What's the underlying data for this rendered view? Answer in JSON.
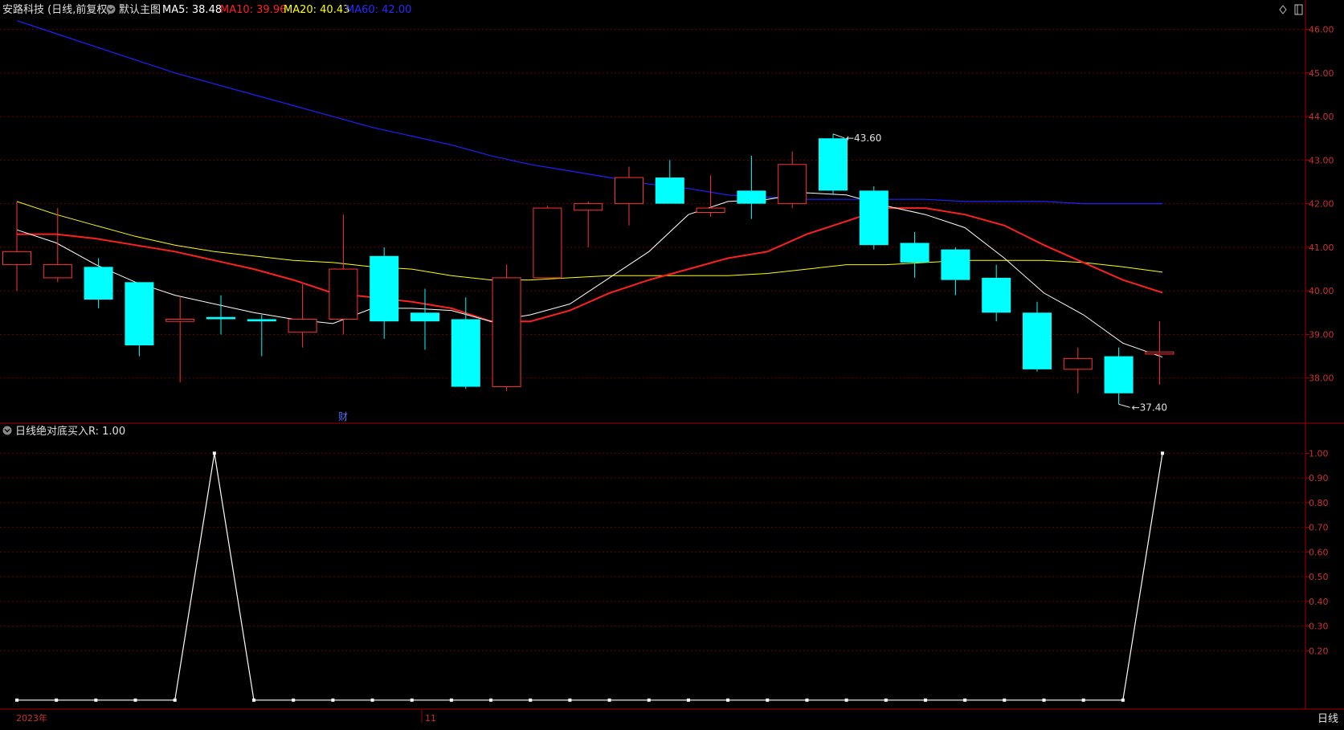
{
  "header": {
    "stock_title": "安路科技 (日线,前复权)",
    "main_chart_label": "默认主图",
    "ma5": {
      "label": "MA5: 38.48",
      "color": "#FFFFFF"
    },
    "ma10": {
      "label": "MA10: 39.96",
      "color": "#FF2020"
    },
    "ma20": {
      "label": "MA20: 40.43",
      "color": "#FFFF00"
    },
    "ma60": {
      "label": "MA60: 42.00",
      "color": "#2020FF"
    }
  },
  "indicator_header": {
    "name": "日线绝对底",
    "value_label": "买入R: 1.00"
  },
  "footer": {
    "period_label": "日线",
    "year_label": "2023年",
    "month_label": "11"
  },
  "annotations": {
    "high_label": "43.60",
    "low_label": "37.40",
    "event_marker": "财"
  },
  "colors": {
    "up": "#FF3232",
    "down": "#00FFFF",
    "axis": "#AA0000",
    "grid": "#6A0000",
    "tick_text": "#C83232",
    "indicator_line": "#FFFFFF"
  },
  "chart_data": [
    {
      "type": "candlestick",
      "title": "安路科技 (日线,前复权)",
      "ylim": [
        37.0,
        46.6
      ],
      "y_ticks": [
        38.0,
        39.0,
        40.0,
        41.0,
        42.0,
        43.0,
        44.0,
        45.0,
        46.0
      ],
      "y_tick_labels": [
        "38.00",
        "39.00",
        "40.00",
        "41.00",
        "42.00",
        "43.00",
        "44.00",
        "45.00",
        "46.00"
      ],
      "candles": [
        {
          "o": 40.6,
          "h": 42.05,
          "l": 40.0,
          "c": 40.9
        },
        {
          "o": 40.3,
          "h": 41.9,
          "l": 40.2,
          "c": 40.6
        },
        {
          "o": 40.55,
          "h": 40.75,
          "l": 39.6,
          "c": 39.8
        },
        {
          "o": 40.2,
          "h": 40.2,
          "l": 38.5,
          "c": 38.75
        },
        {
          "o": 39.3,
          "h": 39.85,
          "l": 37.9,
          "c": 39.35
        },
        {
          "o": 39.4,
          "h": 39.9,
          "l": 39.0,
          "c": 39.35
        },
        {
          "o": 39.35,
          "h": 39.45,
          "l": 38.5,
          "c": 39.3
        },
        {
          "o": 39.05,
          "h": 40.15,
          "l": 38.7,
          "c": 39.35
        },
        {
          "o": 39.35,
          "h": 41.75,
          "l": 39.0,
          "c": 40.5
        },
        {
          "o": 40.8,
          "h": 41.0,
          "l": 38.9,
          "c": 39.3
        },
        {
          "o": 39.5,
          "h": 40.05,
          "l": 38.65,
          "c": 39.3
        },
        {
          "o": 39.35,
          "h": 39.85,
          "l": 37.75,
          "c": 37.8
        },
        {
          "o": 37.8,
          "h": 40.6,
          "l": 37.7,
          "c": 40.3
        },
        {
          "o": 40.3,
          "h": 41.95,
          "l": 40.3,
          "c": 41.9
        },
        {
          "o": 41.85,
          "h": 42.05,
          "l": 41.0,
          "c": 42.0
        },
        {
          "o": 42.0,
          "h": 42.85,
          "l": 41.5,
          "c": 42.6
        },
        {
          "o": 42.6,
          "h": 43.0,
          "l": 42.0,
          "c": 42.0
        },
        {
          "o": 41.8,
          "h": 42.65,
          "l": 41.7,
          "c": 41.9
        },
        {
          "o": 42.3,
          "h": 43.1,
          "l": 41.65,
          "c": 42.0
        },
        {
          "o": 42.0,
          "h": 43.2,
          "l": 41.9,
          "c": 42.9
        },
        {
          "o": 43.5,
          "h": 43.6,
          "l": 42.2,
          "c": 42.3
        },
        {
          "o": 42.3,
          "h": 42.4,
          "l": 40.95,
          "c": 41.05
        },
        {
          "o": 41.1,
          "h": 41.35,
          "l": 40.3,
          "c": 40.65
        },
        {
          "o": 40.95,
          "h": 41.0,
          "l": 39.9,
          "c": 40.25
        },
        {
          "o": 40.3,
          "h": 40.6,
          "l": 39.3,
          "c": 39.5
        },
        {
          "o": 39.5,
          "h": 39.75,
          "l": 38.15,
          "c": 38.2
        },
        {
          "o": 38.2,
          "h": 38.7,
          "l": 37.65,
          "c": 38.45
        },
        {
          "o": 38.5,
          "h": 38.7,
          "l": 37.4,
          "c": 37.65
        },
        {
          "o": 38.55,
          "h": 39.3,
          "l": 37.85,
          "c": 38.6
        }
      ],
      "ma5": [
        41.4,
        41.1,
        40.6,
        40.2,
        39.9,
        39.7,
        39.5,
        39.35,
        39.25,
        39.6,
        39.6,
        39.55,
        39.3,
        39.45,
        39.7,
        40.3,
        40.9,
        41.75,
        42.05,
        42.1,
        42.25,
        42.2,
        41.95,
        41.75,
        41.45,
        40.75,
        39.95,
        39.45,
        38.8,
        38.48
      ],
      "ma10": [
        41.3,
        41.3,
        41.2,
        41.05,
        40.9,
        40.7,
        40.5,
        40.25,
        39.95,
        39.85,
        39.75,
        39.6,
        39.3,
        39.3,
        39.55,
        39.95,
        40.25,
        40.5,
        40.75,
        40.9,
        41.3,
        41.6,
        41.9,
        41.9,
        41.75,
        41.5,
        41.05,
        40.65,
        40.25,
        39.96
      ],
      "ma20": [
        42.05,
        41.75,
        41.5,
        41.25,
        41.05,
        40.9,
        40.8,
        40.7,
        40.65,
        40.55,
        40.5,
        40.35,
        40.25,
        40.25,
        40.3,
        40.35,
        40.35,
        40.35,
        40.35,
        40.4,
        40.5,
        40.6,
        40.6,
        40.65,
        40.7,
        40.7,
        40.7,
        40.65,
        40.55,
        40.43
      ],
      "ma60": [
        46.2,
        45.9,
        45.6,
        45.3,
        45.0,
        44.75,
        44.5,
        44.25,
        44.0,
        43.75,
        43.55,
        43.35,
        43.1,
        42.9,
        42.75,
        42.6,
        42.45,
        42.35,
        42.2,
        42.15,
        42.1,
        42.1,
        42.1,
        42.1,
        42.05,
        42.05,
        42.05,
        42.0,
        42.0,
        42.0
      ],
      "marked_high": 43.6,
      "marked_low": 37.4
    },
    {
      "type": "line",
      "title": "日线绝对底",
      "series": [
        {
          "name": "买入R",
          "values": [
            0,
            0,
            0,
            0,
            0,
            1,
            0,
            0,
            0,
            0,
            0,
            0,
            0,
            0,
            0,
            0,
            0,
            0,
            0,
            0,
            0,
            0,
            0,
            0,
            0,
            0,
            0,
            0,
            0,
            1
          ]
        }
      ],
      "ylim": [
        -0.03,
        1.05
      ],
      "y_ticks": [
        0.2,
        0.3,
        0.4,
        0.5,
        0.6,
        0.7,
        0.8,
        0.9,
        1.0
      ],
      "y_tick_labels": [
        "0.20",
        "0.30",
        "0.40",
        "0.50",
        "0.60",
        "0.70",
        "0.80",
        "0.90",
        "1.00"
      ]
    }
  ]
}
